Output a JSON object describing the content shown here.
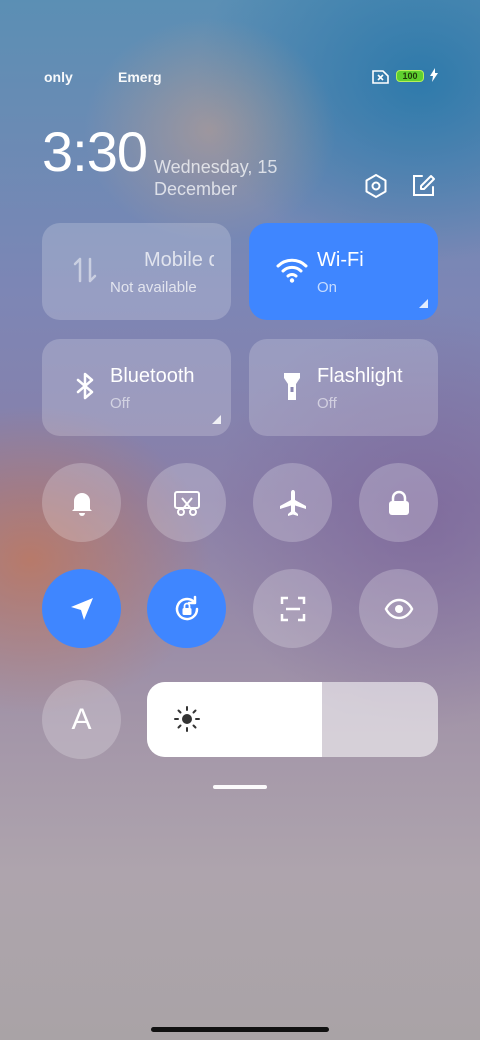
{
  "status_bar": {
    "carrier_1": "only",
    "carrier_2": "Emerg",
    "battery": "100",
    "icons": [
      "no-sim-icon",
      "battery-icon",
      "charging-bolt-icon"
    ]
  },
  "header": {
    "time": "3:30",
    "date": "Wednesday, 15 December",
    "icons": [
      "settings-icon",
      "edit-icon"
    ]
  },
  "tiles": [
    {
      "label": "Mobile data",
      "sub": "Not available",
      "active": false
    },
    {
      "label": "Wi-Fi",
      "sub": "On",
      "active": true
    },
    {
      "label": "Bluetooth",
      "sub": "Off",
      "active": false
    },
    {
      "label": "Flashlight",
      "sub": "Off",
      "active": false
    }
  ],
  "toggles_row1": [
    {
      "icon": "bell-icon",
      "active": false
    },
    {
      "icon": "screenshot-scissors-icon",
      "active": false
    },
    {
      "icon": "airplane-icon",
      "active": false
    },
    {
      "icon": "lock-icon",
      "active": false
    }
  ],
  "toggles_row2": [
    {
      "icon": "location-icon",
      "active": true
    },
    {
      "icon": "rotation-lock-icon",
      "active": true
    },
    {
      "icon": "scanner-icon",
      "active": false
    },
    {
      "icon": "eye-icon",
      "active": false
    }
  ],
  "font_toggle": {
    "label": "A"
  },
  "brightness": {
    "level": 0.6,
    "icon": "sun-icon"
  },
  "colors": {
    "accent": "#3f86ff",
    "battery": "#5fd12f"
  }
}
